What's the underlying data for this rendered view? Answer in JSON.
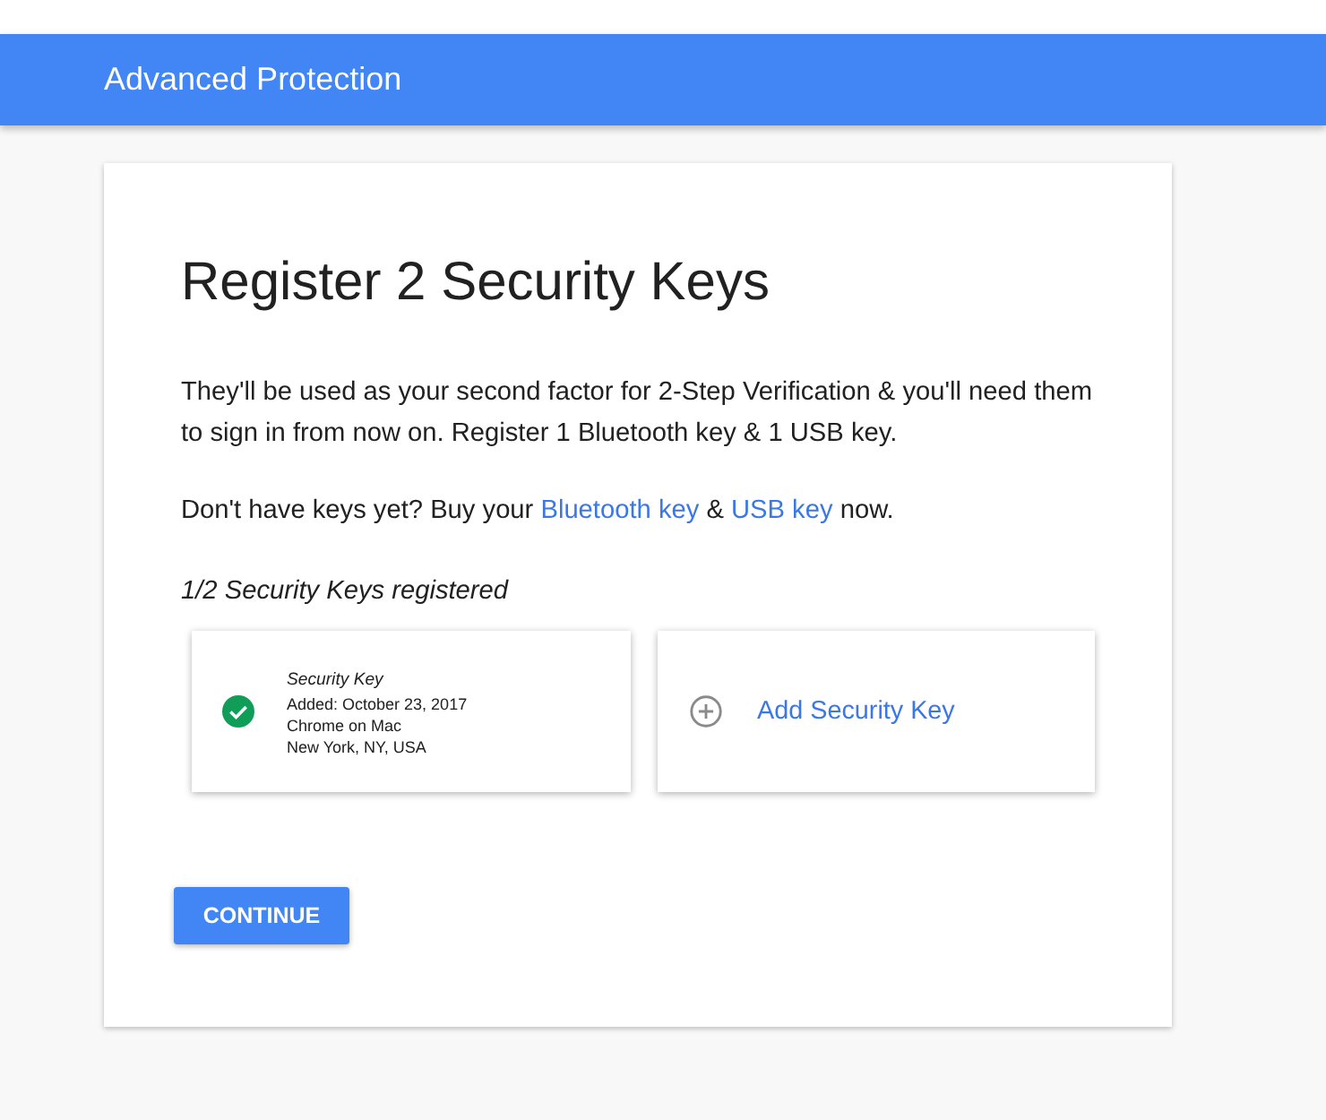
{
  "app_bar": {
    "title": "Advanced Protection"
  },
  "card": {
    "heading": "Register 2 Security Keys",
    "description": "They'll be used as your second factor for 2-Step Verification & you'll need them to sign in from now on. Register 1 Bluetooth key & 1 USB key.",
    "buy_line": [
      {
        "kind": "text",
        "text": "Don't have keys yet? Buy your "
      },
      {
        "kind": "link",
        "text": "Bluetooth key"
      },
      {
        "kind": "text",
        "text": " & "
      },
      {
        "kind": "link",
        "text": "USB key"
      },
      {
        "kind": "text",
        "text": " now."
      }
    ],
    "status": "1/2 Security Keys registered",
    "keys": [
      {
        "kind": "registered",
        "title": "Security Key",
        "details": [
          "Added: October 23, 2017",
          "Chrome on Mac",
          "New York, NY, USA"
        ]
      },
      {
        "kind": "add",
        "label": "Add Security Key"
      }
    ],
    "button": "CONTINUE"
  }
}
